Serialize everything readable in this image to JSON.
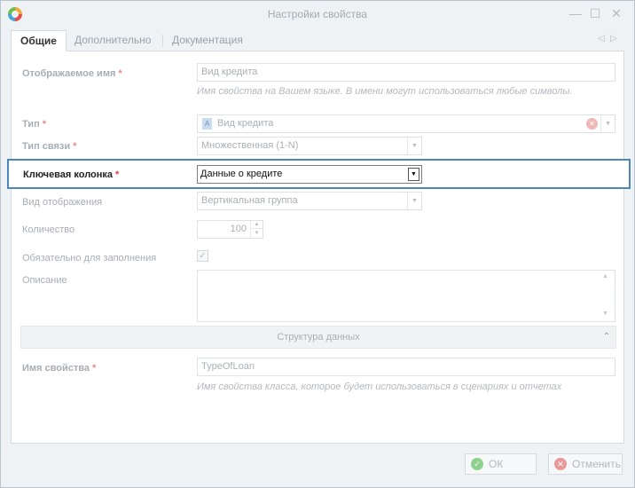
{
  "window": {
    "title": "Настройки свойства",
    "minimize_glyph": "—",
    "maximize_glyph": "☐",
    "close_glyph": "✕"
  },
  "tabs": [
    {
      "label": "Общие",
      "active": true
    },
    {
      "label": "Дополнительно",
      "active": false
    },
    {
      "label": "Документация",
      "active": false
    }
  ],
  "tab_nav": {
    "prev_glyph": "◁",
    "next_glyph": "▷"
  },
  "fields": {
    "display_name": {
      "label": "Отображаемое имя",
      "value": "Вид кредита",
      "hint": "Имя свойства на Вашем языке. В имени могут использоваться любые символы."
    },
    "type": {
      "label": "Тип",
      "value": "Вид кредита"
    },
    "relation_type": {
      "label": "Тип связи",
      "value": "Множественная (1-N)"
    },
    "key_column": {
      "label": "Ключевая колонка",
      "value": "Данные о кредите"
    },
    "display_view": {
      "label": "Вид отображения",
      "value": "Вертикальная группа"
    },
    "quantity": {
      "label": "Количество",
      "value": "100"
    },
    "required": {
      "label": "Обязательно для заполнения",
      "checked": true
    },
    "description": {
      "label": "Описание",
      "value": ""
    }
  },
  "section": {
    "title": "Структура данных"
  },
  "property_name": {
    "label": "Имя свойства",
    "value": "TypeOfLoan",
    "hint": "Имя свойства класса, которое будет использоваться в сценариях и отчетах"
  },
  "required_mark": "*",
  "icons": {
    "dropdown": "▼",
    "spin_up": "▲",
    "spin_down": "▼",
    "check": "✓",
    "clear": "✕",
    "collapse": "⌃",
    "type_badge": "A"
  },
  "buttons": {
    "ok": "ОК",
    "cancel": "Отменить"
  },
  "colors": {
    "accent": "#4d86b8",
    "required": "#d94242",
    "ok_icon": "#8fd28f",
    "cancel_icon": "#e89a9a"
  }
}
